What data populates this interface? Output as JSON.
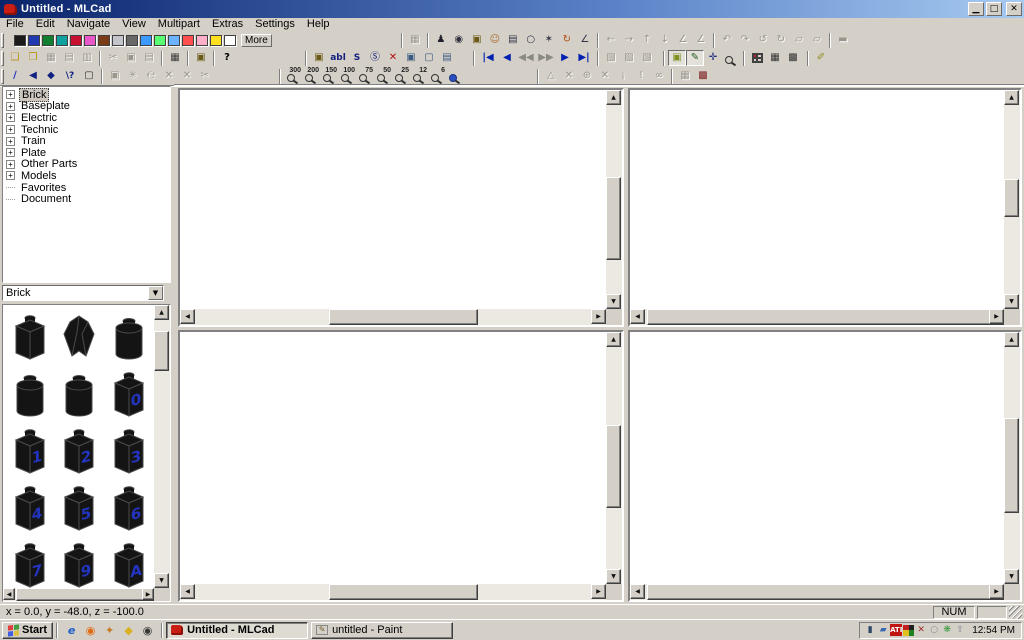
{
  "window": {
    "title": "Untitled - MLCad",
    "minimize_glyph": "▁",
    "maximize_glyph": "□",
    "close_glyph": "✕"
  },
  "glyphs": {
    "up": "▲",
    "down": "▼",
    "left": "◀",
    "right": "▶",
    "combo_arrow": "▼",
    "plus": "+"
  },
  "menu": {
    "items": [
      "File",
      "Edit",
      "Navigate",
      "View",
      "Multipart",
      "Extras",
      "Settings",
      "Help"
    ]
  },
  "palette": {
    "more_label": "More",
    "colors": [
      "#1b1b1b",
      "#2038b0",
      "#108030",
      "#10a0a0",
      "#c81030",
      "#e858c8",
      "#7a3c14",
      "#c4c4cc",
      "#686868",
      "#3d9aff",
      "#58ff70",
      "#6cb4ff",
      "#ff5050",
      "#ffb0c8",
      "#ffe020",
      "#ffffff"
    ]
  },
  "toolbars": {
    "row1": [
      {
        "ml": 126,
        "buttons": [
          {
            "name": "snapshot",
            "glyph": "▦",
            "disabled": true
          }
        ]
      },
      {
        "buttons": [
          {
            "name": "add-minifig",
            "glyph": "♟",
            "color": "#20202e"
          },
          {
            "name": "rotation-point",
            "glyph": "◉",
            "color": "#30303e"
          },
          {
            "name": "add-part",
            "glyph": "▣",
            "color": "#6b5a16"
          },
          {
            "name": "minifig-head",
            "glyph": "☺",
            "color": "#a9682a"
          },
          {
            "name": "camera-view",
            "glyph": "▤",
            "color": "#34344a"
          },
          {
            "name": "add-ring",
            "glyph": "○",
            "color": "#34344a"
          },
          {
            "name": "add-gear",
            "glyph": "✶",
            "color": "#34344a"
          },
          {
            "name": "rotate-part",
            "glyph": "↻",
            "color": "#b44a08"
          },
          {
            "name": "angle-tool",
            "glyph": "∠",
            "color": "#34344a"
          }
        ]
      },
      {
        "buttons": [
          {
            "name": "move-left",
            "glyph": "←",
            "disabled": true
          },
          {
            "name": "move-right",
            "glyph": "→",
            "disabled": true
          },
          {
            "name": "move-up",
            "glyph": "↑",
            "disabled": true
          },
          {
            "name": "move-down",
            "glyph": "↓",
            "disabled": true
          },
          {
            "name": "pitch-tool",
            "glyph": "∠",
            "disabled": true
          },
          {
            "name": "yaw-tool",
            "glyph": "∠",
            "disabled": true
          }
        ]
      },
      {
        "buttons": [
          {
            "name": "rotate-x-neg",
            "glyph": "↶",
            "disabled": true
          },
          {
            "name": "rotate-x-pos",
            "glyph": "↷",
            "disabled": true
          },
          {
            "name": "rotate-y-neg",
            "glyph": "↺",
            "disabled": true
          },
          {
            "name": "rotate-y-pos",
            "glyph": "↻",
            "disabled": true
          },
          {
            "name": "rotate-z-neg",
            "glyph": "▱",
            "disabled": true
          },
          {
            "name": "rotate-z-pos",
            "glyph": "▱",
            "disabled": true
          }
        ]
      },
      {
        "buttons": [
          {
            "name": "enter-pos-rot",
            "glyph": "▬",
            "disabled": true
          }
        ]
      }
    ],
    "row2": [
      {
        "buttons": [
          {
            "name": "new-file",
            "glyph": "❑",
            "color": "#b99316"
          },
          {
            "name": "open-file",
            "glyph": "❒",
            "color": "#b99316"
          },
          {
            "name": "save-file",
            "glyph": "▦",
            "disabled": true
          },
          {
            "name": "import",
            "glyph": "▤",
            "disabled": true
          },
          {
            "name": "export",
            "glyph": "▥",
            "disabled": true
          }
        ]
      },
      {
        "buttons": [
          {
            "name": "cut",
            "glyph": "✂",
            "disabled": true
          },
          {
            "name": "copy",
            "glyph": "▣",
            "disabled": true
          },
          {
            "name": "paste",
            "glyph": "▤",
            "disabled": true
          }
        ]
      },
      {
        "buttons": [
          {
            "name": "print",
            "glyph": "▦",
            "color": "#3a3a3a"
          }
        ]
      },
      {
        "buttons": [
          {
            "name": "properties",
            "glyph": "▣",
            "color": "#6b5a16"
          }
        ]
      },
      {
        "buttons": [
          {
            "name": "context-help",
            "glyph": "?",
            "color": "#000",
            "bold": true
          }
        ]
      },
      {
        "ml": 66,
        "buttons": [
          {
            "name": "add-part-element",
            "glyph": "▣",
            "color": "#6b5a16"
          },
          {
            "name": "add-comment",
            "glyph": "abl",
            "text": true,
            "color": "#14207e"
          },
          {
            "name": "add-step",
            "glyph": "S",
            "text": true,
            "color": "#14207e"
          },
          {
            "name": "add-rotation-step",
            "glyph": "Ⓢ",
            "color": "#14207e"
          },
          {
            "name": "delete-element",
            "glyph": "✕",
            "color": "#b01010"
          },
          {
            "name": "add-buffer",
            "glyph": "▣",
            "color": "#3a5a80"
          },
          {
            "name": "add-ghost",
            "glyph": "▢",
            "color": "#3a5a80"
          },
          {
            "name": "add-background",
            "glyph": "▤",
            "color": "#3a5a80"
          }
        ]
      },
      {
        "ml": 14,
        "buttons": [
          {
            "name": "go-first-step",
            "glyph": "|◀",
            "color": "#0020b0",
            "bold": true
          },
          {
            "name": "go-prev-step",
            "glyph": "◀",
            "color": "#0020b0",
            "bold": true
          },
          {
            "name": "play-back",
            "glyph": "◀◀",
            "color": "#8a8a82",
            "bold": true
          },
          {
            "name": "play-forward",
            "glyph": "▶▶",
            "color": "#8a8a82",
            "bold": true
          },
          {
            "name": "go-next-step",
            "glyph": "▶",
            "color": "#0020b0",
            "bold": true
          },
          {
            "name": "go-last-step",
            "glyph": "▶|",
            "color": "#0020b0",
            "bold": true
          }
        ]
      },
      {
        "buttons": [
          {
            "name": "view-camera-1",
            "glyph": "▧",
            "disabled": true
          },
          {
            "name": "view-camera-2",
            "glyph": "▨",
            "disabled": true
          },
          {
            "name": "view-camera-3",
            "glyph": "▧",
            "disabled": true
          }
        ]
      },
      {
        "ml": 4,
        "buttons": [
          {
            "name": "place-mode",
            "glyph": "▣",
            "color": "#7e9020",
            "pressed": true
          },
          {
            "name": "select-mode",
            "glyph": "✎",
            "color": "#1e5a1e",
            "pressed": true
          },
          {
            "name": "move-mode",
            "glyph": "✛",
            "color": "#203080"
          },
          {
            "name": "zoom-mode",
            "kind": "mag"
          }
        ]
      },
      {
        "buttons": [
          {
            "name": "view-panes-red",
            "kind": "quad"
          },
          {
            "name": "view-grid",
            "glyph": "▦",
            "color": "#303030"
          },
          {
            "name": "view-single-pane",
            "glyph": "▩",
            "color": "#303030"
          }
        ]
      },
      {
        "ml": 2,
        "buttons": [
          {
            "name": "draw-to-selection",
            "glyph": "✐",
            "color": "#8e8e20"
          }
        ]
      }
    ],
    "row3": [
      {
        "buttons": [
          {
            "name": "draw-line",
            "glyph": "∕",
            "color": "#2030c0",
            "bold": true
          },
          {
            "name": "draw-triangle",
            "glyph": "◀",
            "color": "#102080"
          },
          {
            "name": "draw-quad",
            "glyph": "◆",
            "color": "#102080"
          },
          {
            "name": "draw-condline",
            "glyph": "\\?",
            "text": true,
            "color": "#102080"
          },
          {
            "name": "draw-comment",
            "glyph": "▢",
            "color": "#303030"
          }
        ]
      },
      {
        "buttons": [
          {
            "name": "edit-vertices",
            "glyph": "▣",
            "disabled": true
          },
          {
            "name": "flex-hose",
            "glyph": "✳",
            "disabled": true
          },
          {
            "name": "spring-tool",
            "glyph": "℮",
            "disabled": true
          },
          {
            "name": "delete-vertex",
            "glyph": "✕",
            "disabled": true
          },
          {
            "name": "delete-all",
            "glyph": "✕",
            "disabled": true
          },
          {
            "name": "split-tool",
            "glyph": "✂",
            "disabled": true
          }
        ]
      },
      {
        "ml": 62,
        "buttons": [
          {
            "name": "zoom-300",
            "kind": "mag",
            "num": "300"
          },
          {
            "name": "zoom-200",
            "kind": "mag",
            "num": "200"
          },
          {
            "name": "zoom-150",
            "kind": "mag",
            "num": "150"
          },
          {
            "name": "zoom-100",
            "kind": "mag",
            "num": "100"
          },
          {
            "name": "zoom-75",
            "kind": "mag",
            "num": "75"
          },
          {
            "name": "zoom-50",
            "kind": "mag",
            "num": "50"
          },
          {
            "name": "zoom-25",
            "kind": "mag",
            "num": "25"
          },
          {
            "name": "zoom-12",
            "kind": "mag",
            "num": "12"
          },
          {
            "name": "zoom-6",
            "kind": "mag",
            "num": "6"
          },
          {
            "name": "zoom-fit",
            "kind": "globe"
          }
        ]
      },
      {
        "ml": 70,
        "buttons": [
          {
            "name": "hide-part",
            "glyph": "△",
            "disabled": true
          },
          {
            "name": "unhide-part",
            "glyph": "✕",
            "disabled": true
          },
          {
            "name": "snap-grid",
            "glyph": "⊕",
            "disabled": true
          },
          {
            "name": "unsnap-grid",
            "glyph": "✕",
            "disabled": true
          },
          {
            "name": "light-on",
            "glyph": "¡",
            "disabled": true
          },
          {
            "name": "light-off",
            "glyph": "!",
            "disabled": true
          },
          {
            "name": "link-parts",
            "glyph": "∞",
            "disabled": true
          }
        ]
      },
      {
        "buttons": [
          {
            "name": "grid-settings",
            "glyph": "▦",
            "disabled": true
          },
          {
            "name": "render-view",
            "glyph": "▩",
            "color": "#7e2020"
          }
        ]
      }
    ]
  },
  "sidebar": {
    "tree": [
      {
        "label": "Brick",
        "expandable": true,
        "selected": true
      },
      {
        "label": "Baseplate",
        "expandable": true
      },
      {
        "label": "Electric",
        "expandable": true
      },
      {
        "label": "Technic",
        "expandable": true
      },
      {
        "label": "Train",
        "expandable": true
      },
      {
        "label": "Plate",
        "expandable": true
      },
      {
        "label": "Other Parts",
        "expandable": true
      },
      {
        "label": "Models",
        "expandable": true
      },
      {
        "label": "Favorites",
        "expandable": false
      },
      {
        "label": "Document",
        "expandable": false
      }
    ],
    "combo": {
      "value": "Brick"
    },
    "parts": [
      {
        "type": "brick",
        "label": ""
      },
      {
        "type": "rock",
        "label": ""
      },
      {
        "type": "round",
        "label": ""
      },
      {
        "type": "round",
        "label": ""
      },
      {
        "type": "round",
        "label": ""
      },
      {
        "type": "brick",
        "label": "0"
      },
      {
        "type": "brick",
        "label": "1"
      },
      {
        "type": "brick",
        "label": "2"
      },
      {
        "type": "brick",
        "label": "3"
      },
      {
        "type": "brick",
        "label": "4"
      },
      {
        "type": "brick",
        "label": "5"
      },
      {
        "type": "brick",
        "label": "6"
      },
      {
        "type": "brick",
        "label": "7"
      },
      {
        "type": "brick",
        "label": "9"
      },
      {
        "type": "brick",
        "label": "A"
      }
    ],
    "part_label_color": "#2335c0"
  },
  "statusbar": {
    "coords": "x = 0.0, y = -48.0, z = -100.0",
    "num_indicator": "NUM"
  },
  "taskbar": {
    "start_label": "Start",
    "flag_colors": [
      "#e04040",
      "#40a040",
      "#4060e0",
      "#e0c040"
    ],
    "quicklaunch": [
      {
        "name": "internet-explorer-icon",
        "glyph": "e",
        "color": "#2060c8"
      },
      {
        "name": "firefox-icon",
        "glyph": "◉",
        "color": "#e06a10"
      },
      {
        "name": "messenger-icon",
        "glyph": "✦",
        "color": "#c87828"
      },
      {
        "name": "acrobat-icon",
        "glyph": "◆",
        "color": "#d8b020"
      },
      {
        "name": "media-player-icon",
        "glyph": "◉",
        "color": "#383838"
      }
    ],
    "tasks": [
      {
        "label": "Untitled - MLCad",
        "active": true
      },
      {
        "label": "untitled - Paint",
        "active": false
      }
    ],
    "tray": [
      {
        "name": "network-monitor-icon",
        "glyph": "▮",
        "color": "#304868"
      },
      {
        "name": "display-settings-icon",
        "glyph": "▰",
        "color": "#3868b0"
      },
      {
        "name": "ati-tray-icon",
        "glyph": "ATI",
        "chip": true
      },
      {
        "name": "color-profile-icon",
        "quad": [
          "#c02020",
          "#202020",
          "#e0c020",
          "#208020"
        ]
      },
      {
        "name": "volume-icon",
        "glyph": "✕",
        "color": "#a03030"
      },
      {
        "name": "scheduler-icon",
        "glyph": "○",
        "color": "#8a8a8a"
      },
      {
        "name": "update-icon",
        "glyph": "❋",
        "color": "#3a9a3a"
      },
      {
        "name": "removable-device-icon",
        "glyph": "⇪",
        "color": "#9a9aa2"
      }
    ],
    "clock": "12:54 PM"
  }
}
